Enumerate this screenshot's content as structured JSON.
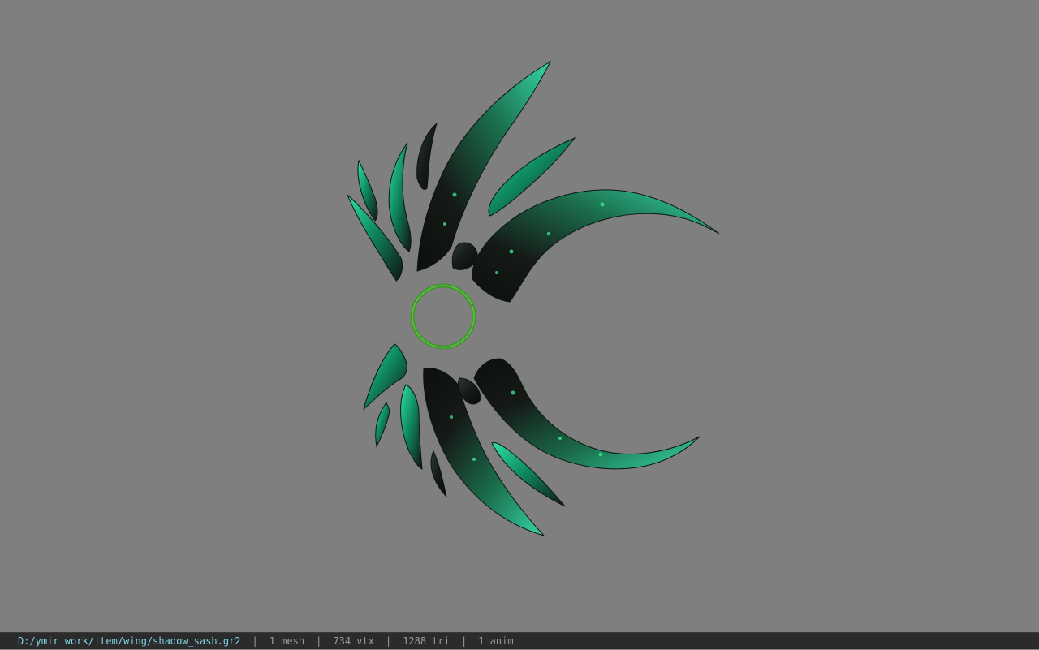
{
  "viewer": {
    "background_color": "#7f7f7f",
    "model_name": "shadow_sash",
    "accent_colors": {
      "teal_highlight": "#2fd3a0",
      "emerald": "#0f8a5e",
      "dark_shell": "#1a1f1c",
      "ring_green": "#3c9a2a"
    }
  },
  "status_bar": {
    "file_path": "D:/ymir work/item/wing/shadow_sash.gr2",
    "separator": "|",
    "mesh_count": "1 mesh",
    "vertex_count": "734 vtx",
    "triangle_count": "1288 tri",
    "anim_count": "1 anim"
  }
}
